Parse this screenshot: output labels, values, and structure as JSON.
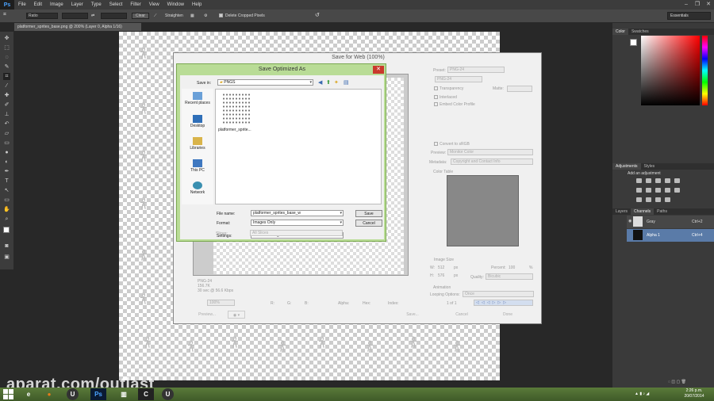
{
  "app": {
    "logo": "Ps",
    "menu": [
      "File",
      "Edit",
      "Image",
      "Layer",
      "Type",
      "Select",
      "Filter",
      "View",
      "Window",
      "Help"
    ],
    "window_controls": [
      "–",
      "❐",
      "✕"
    ]
  },
  "options_bar": {
    "ratio": "Ratio",
    "clear": "Clear",
    "straighten": "Straighten",
    "delete_cropped": "Delete Cropped Pixels",
    "workspace": "Essentials"
  },
  "document": {
    "tab_title": "platformer_sprites_base.png @ 200% (Layer 0, Alpha 1/16)"
  },
  "panels": {
    "color_tabs": [
      "Color",
      "Swatches"
    ],
    "adjust_tabs": [
      "Adjustments",
      "Styles"
    ],
    "add_adjustment": "Add an adjustment",
    "layer_tabs": [
      "Layers",
      "Channels",
      "Paths"
    ],
    "channels": [
      {
        "name": "Gray",
        "shortcut": "Ctrl+2"
      },
      {
        "name": "Alpha 1",
        "shortcut": "Ctrl+4"
      }
    ]
  },
  "save_for_web": {
    "title": "Save for Web (100%)",
    "preset_label": "Preset:",
    "preset_value": "PNG-24",
    "format_value": "PNG-24",
    "transparency": "Transparency",
    "matte_label": "Matte:",
    "interlaced": "Interlaced",
    "embed_color": "Embed Color Profile",
    "convert_srgb": "Convert to sRGB",
    "preview_label": "Preview:",
    "preview_value": "Monitor Color",
    "metadata_label": "Metadata:",
    "metadata_value": "Copyright and Contact Info",
    "color_table": "Color Table",
    "image_size": "Image Size",
    "w_label": "W:",
    "w_value": "512",
    "h_label": "H:",
    "h_value": "576",
    "px": "px",
    "percent_label": "Percent:",
    "percent_value": "100",
    "pct": "%",
    "quality_label": "Quality:",
    "quality_value": "Bicubic",
    "animation": "Animation",
    "looping_label": "Looping Options:",
    "looping_value": "Once",
    "frame_counter": "1 of 1",
    "info_format": "PNG-24",
    "info_size": "156.7K",
    "info_time": "30 sec @ 56.6 Kbps",
    "zoom": "100%",
    "r_label": "R:",
    "g_label": "G:",
    "b_label": "B:",
    "alpha_label": "Alpha:",
    "hex_label": "Hex:",
    "index_label": "Index:",
    "preview_btn": "Preview...",
    "save_btn": "Save...",
    "cancel_btn": "Cancel",
    "done_btn": "Done"
  },
  "save_dialog": {
    "title": "Save Optimized As",
    "save_in_label": "Save in:",
    "save_in_value": "PNGS",
    "places": [
      "Recent places",
      "Desktop",
      "Libraries",
      "This PC",
      "Network"
    ],
    "file_item": "platformer_sprite...",
    "file_name_label": "File name:",
    "file_name_value": "platformer_sprites_base_w",
    "format_label": "Format:",
    "format_value": "Images Only",
    "settings_label": "Settings:",
    "settings_value": "Default Settings",
    "slices_label": "Slices:",
    "slices_value": "All Slices",
    "save_btn": "Save",
    "cancel_btn": "Cancel"
  },
  "taskbar": {
    "time": "2:26 p.m.",
    "date": "20/07/2014"
  },
  "watermark": "aparat.com/outlast"
}
